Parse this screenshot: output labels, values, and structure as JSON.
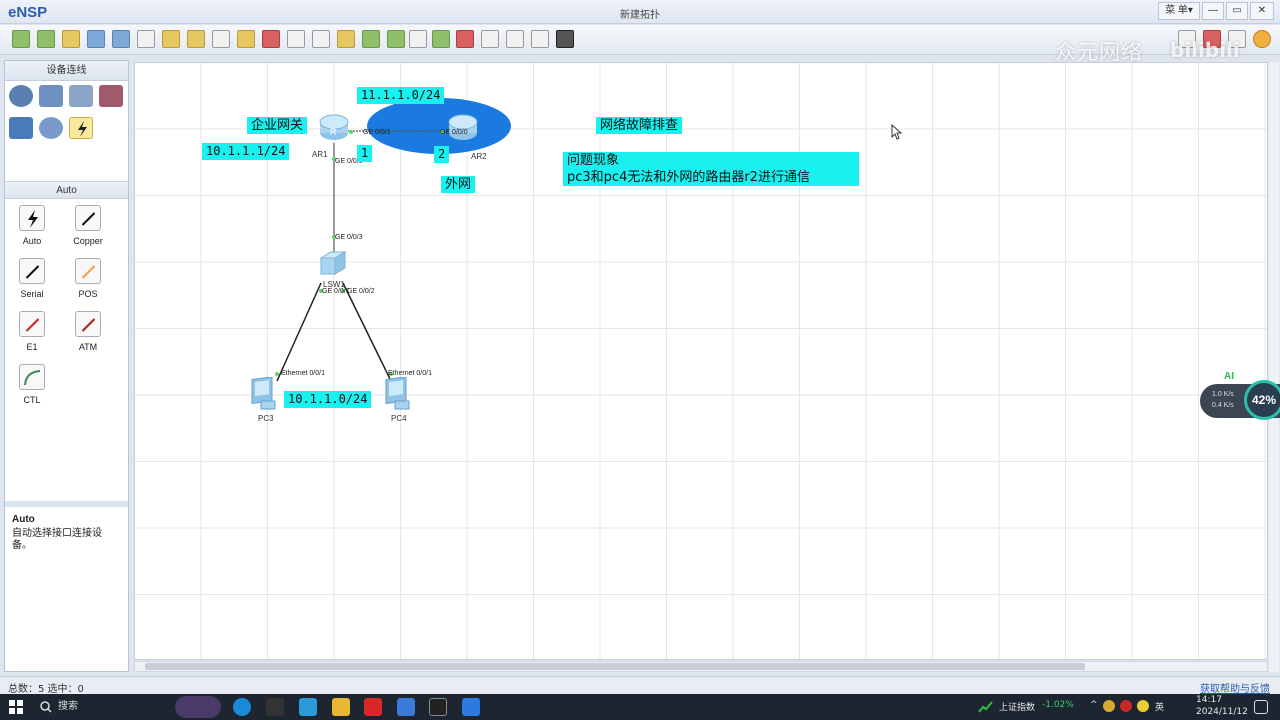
{
  "app": {
    "logo": "eNSP",
    "window_title": "新建拓扑",
    "menu_label": "菜 单▾",
    "minimize": "—",
    "restore": "▭",
    "close": "✕"
  },
  "watermark": {
    "text": "众元网络",
    "brand": "bilibili"
  },
  "left_panel": {
    "device_header": "设备连线",
    "cable_header": "Auto",
    "cables": [
      {
        "label": "Auto",
        "color": "#111111"
      },
      {
        "label": "Copper",
        "color": "#111111"
      },
      {
        "label": "Serial",
        "color": "#111111"
      },
      {
        "label": "POS",
        "color": "#f0a040"
      },
      {
        "label": "E1",
        "color": "#c82020"
      },
      {
        "label": "ATM",
        "color": "#a02020"
      },
      {
        "label": "CTL",
        "color": "#3a8a5a"
      }
    ],
    "help_title": "Auto",
    "help_text": "自动选择接口连接设备。"
  },
  "topology": {
    "nodes": {
      "ar1": "AR1",
      "ar2": "AR2",
      "lsw1": "LSW1",
      "pc3": "PC3",
      "pc4": "PC4"
    },
    "ports": {
      "ar1_ge001": "GE 0/0/1",
      "ar2_ge000": "GE 0/0/0",
      "ar1_ge000": "GE 0/0/0",
      "lsw_ge003": "GE 0/0/3",
      "lsw_ge001": "GE 0/0/1",
      "lsw_ge002": "GE 0/0/2",
      "pc3_eth": "Ethernet 0/0/1",
      "pc4_eth": "Ethernet 0/0/1"
    },
    "labels": {
      "wan_net": "11.1.1.0/24",
      "enterprise_gw": "企业网关",
      "gw_ip": "10.1.1.1/24",
      "num1": "1",
      "num2": "2",
      "external": "外网",
      "lan_net": "10.1.1.0/24",
      "title": "网络故障排查",
      "problem_title": "问题现象",
      "problem_desc": "pc3和pc4无法和外网的路由器r2进行通信"
    }
  },
  "status_bar": {
    "left": "总数：5  选中：0",
    "right": "获取帮助与反馈"
  },
  "widget": {
    "percent": "42%",
    "ai": "AI",
    "up": "1.0 K/s",
    "down": "0.4 K/s"
  },
  "taskbar": {
    "search": "搜索",
    "stock_name": "上证指数",
    "stock_change": "-1.02%",
    "ime": "英",
    "time": "14:17",
    "date": "2024/11/12"
  }
}
